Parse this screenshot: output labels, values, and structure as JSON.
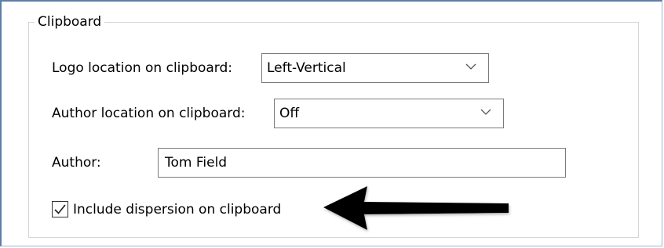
{
  "group": {
    "title": "Clipboard"
  },
  "logo_location": {
    "label": "Logo location on clipboard:",
    "value": "Left-Vertical"
  },
  "author_location": {
    "label": "Author location on clipboard:",
    "value": "Off"
  },
  "author": {
    "label": "Author:",
    "value": "Tom Field"
  },
  "dispersion": {
    "label": "Include dispersion on clipboard",
    "checked": true
  },
  "icons": {
    "dropdown": "chevron-down-icon",
    "check": "checkmark-icon",
    "annotation": "arrow-left-icon"
  },
  "colors": {
    "annotation_arrow": "#000000",
    "window_border": "#5b7fa6"
  }
}
